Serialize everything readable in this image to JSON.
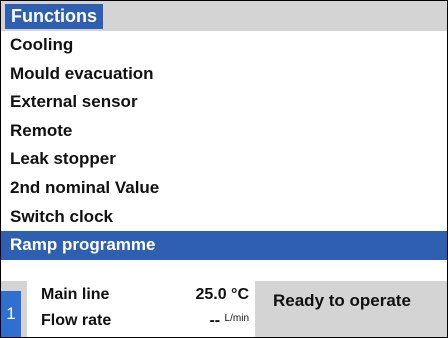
{
  "title": "Functions",
  "menu": {
    "items": [
      {
        "label": "Cooling"
      },
      {
        "label": "Mould evacuation"
      },
      {
        "label": "External sensor"
      },
      {
        "label": "Remote"
      },
      {
        "label": "Leak stopper"
      },
      {
        "label": "2nd nominal Value"
      },
      {
        "label": "Switch clock"
      },
      {
        "label": "Ramp programme"
      }
    ],
    "selected_index": 7
  },
  "status": {
    "channel": "1",
    "main_line_label": "Main line",
    "main_line_value": "25.0 °C",
    "flow_rate_label": "Flow rate",
    "flow_rate_value": "--",
    "flow_rate_unit": "L/min",
    "message": "Ready to operate"
  },
  "colors": {
    "selection": "#2f5fb0",
    "background_gray": "#d4d4d4"
  }
}
